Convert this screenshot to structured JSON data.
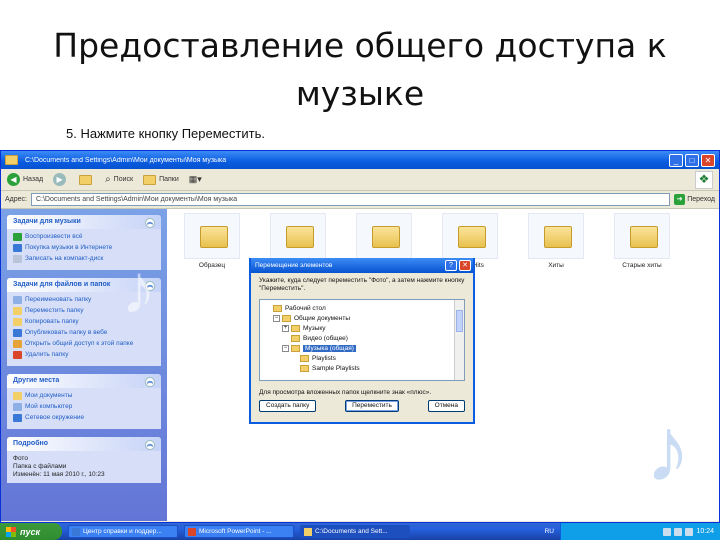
{
  "slide": {
    "title_line1": "Предоставление общего доступа к",
    "title_line2": "музыке",
    "step": "5. Нажмите кнопку Переместить."
  },
  "window": {
    "title": "C:\\Documents and Settings\\Admin\\Мои документы\\Моя музыка",
    "controls": {
      "minimize": "_",
      "maximize": "□",
      "close": "✕"
    }
  },
  "toolbar": {
    "back": "Назад",
    "forward": "",
    "search": "Поиск",
    "folders": "Папки"
  },
  "address": {
    "label": "Адрес:",
    "value": "C:\\Documents and Settings\\Admin\\Мои документы\\Моя музыка",
    "go": "Переход"
  },
  "taskpane": {
    "music_tasks": {
      "title": "Задачи для музыки",
      "items": [
        "Воспроизвести всё",
        "Покупка музыки в Интернете",
        "Записать на компакт-диск"
      ]
    },
    "file_tasks": {
      "title": "Задачи для файлов и папок",
      "items": [
        "Переименовать папку",
        "Переместить папку",
        "Копировать папку",
        "Опубликовать папку в вебе",
        "Открыть общий доступ к этой папке",
        "Удалить папку"
      ]
    },
    "other_places": {
      "title": "Другие места",
      "items": [
        "Мои документы",
        "Мой компьютер",
        "Сетевое окружение"
      ]
    },
    "details": {
      "title": "Подробно",
      "lines": [
        "Фото",
        "Папка с файлами",
        "Изменён: 11 мая 2010 г., 10:23"
      ]
    }
  },
  "files": [
    {
      "name": "Образец"
    },
    {
      "name": ""
    },
    {
      "name": ""
    },
    {
      "name": "Rock Hits"
    },
    {
      "name": "Хиты"
    },
    {
      "name": "Старые хиты"
    }
  ],
  "dialog": {
    "title": "Перемещение элементов",
    "instruction": "Укажите, куда следует переместить \"Фото\", а затем нажмите кнопку \"Переместить\".",
    "tree": [
      {
        "label": "Рабочий стол",
        "expander": "",
        "indent": 0,
        "selected": false
      },
      {
        "label": "Общие документы",
        "expander": "−",
        "indent": 1,
        "selected": false
      },
      {
        "label": "Музыку",
        "expander": "+",
        "indent": 2,
        "selected": false
      },
      {
        "label": "Видео (общее)",
        "expander": "",
        "indent": 2,
        "selected": false
      },
      {
        "label": "Музыка (общая)",
        "expander": "−",
        "indent": 2,
        "selected": true
      },
      {
        "label": "Playlists",
        "expander": "",
        "indent": 3,
        "selected": false
      },
      {
        "label": "Sample Playlists",
        "expander": "",
        "indent": 3,
        "selected": false
      }
    ],
    "hint": "Для просмотра вложенных папок щелкните знак «плюс».",
    "buttons": {
      "new_folder": "Создать папку",
      "move": "Переместить",
      "cancel": "Отмена"
    }
  },
  "taskbar": {
    "start": "пуск",
    "buttons": [
      "Центр справки и поддер...",
      "Microsoft PowerPoint - ...",
      "C:\\Documents and Sett..."
    ],
    "lang": "RU",
    "time": "10:24"
  }
}
